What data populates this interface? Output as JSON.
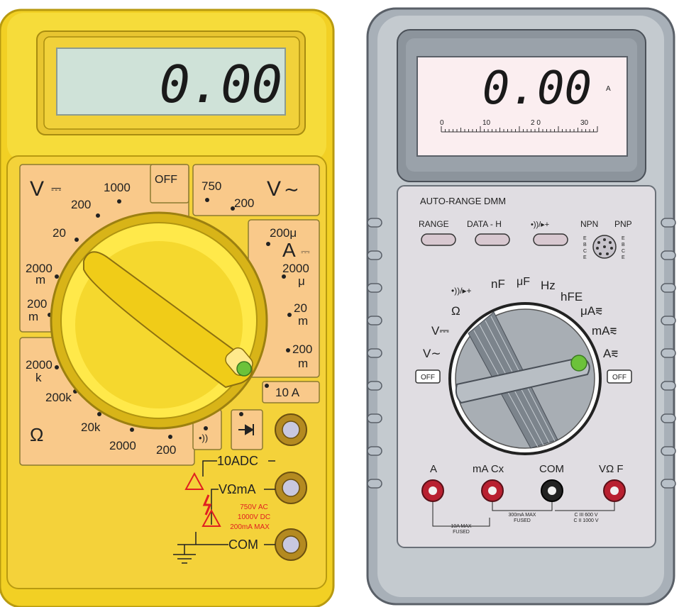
{
  "left_meter": {
    "display": "0.00",
    "dc_volts_label": "V",
    "dc_sym": "⎓",
    "ac_volts_label": "V",
    "ac_sym": "∼",
    "dc_amp_label": "A",
    "ohm_label": "Ω",
    "off_label": "OFF",
    "ranges": {
      "v1000": "1000",
      "v200": "200",
      "v20": "20",
      "v2000m_a": "2000",
      "v2000m_b": "m",
      "v200m_a": "200",
      "v200m_b": "m",
      "ac750": "750",
      "ac200": "200",
      "a200u": "200μ",
      "a2000u_a": "2000",
      "a2000u_b": "μ",
      "a20m_a": "20",
      "a20m_b": "m",
      "a200m_a": "200",
      "a200m_b": "m",
      "a10": "10 A",
      "r2000k_a": "2000",
      "r2000k_b": "k",
      "r200k": "200k",
      "r20k": "20k",
      "r2000": "2000",
      "r200": "200"
    },
    "jacks": {
      "adc10": "10ADC",
      "vohm": "VΩmA",
      "com": "COM"
    },
    "warning": [
      "750V AC",
      "1000V DC",
      "200mA MAX"
    ]
  },
  "right_meter": {
    "display": "0.00",
    "unit": "A",
    "scale_labels": [
      "0",
      "10",
      "2 0",
      "30"
    ],
    "brand": "AUTO-RANGE DMM",
    "buttons": [
      "RANGE",
      "DATA - H",
      "•))/▸+"
    ],
    "npn": "NPN",
    "pnp": "PNP",
    "ebce": [
      "E",
      "B",
      "C",
      "E"
    ],
    "dial": {
      "nf": "nF",
      "uf": "μF",
      "hz": "Hz",
      "hfe": "hFE",
      "ohm": "Ω",
      "vdc": "V⎓",
      "vac": "V∼",
      "ua": "μA⩳",
      "ma": "mA⩳",
      "a": "A⩳",
      "off_left": "OFF",
      "off_right": "OFF"
    },
    "jacks": [
      "A",
      "mA Cx",
      "COM",
      "VΩ F"
    ],
    "notes": {
      "a10": [
        "10A MAX",
        "FUSED"
      ],
      "ma300": [
        "300mA MAX",
        "FUSED"
      ],
      "cat": [
        "C III 600 V",
        "C II 1000 V"
      ]
    }
  }
}
